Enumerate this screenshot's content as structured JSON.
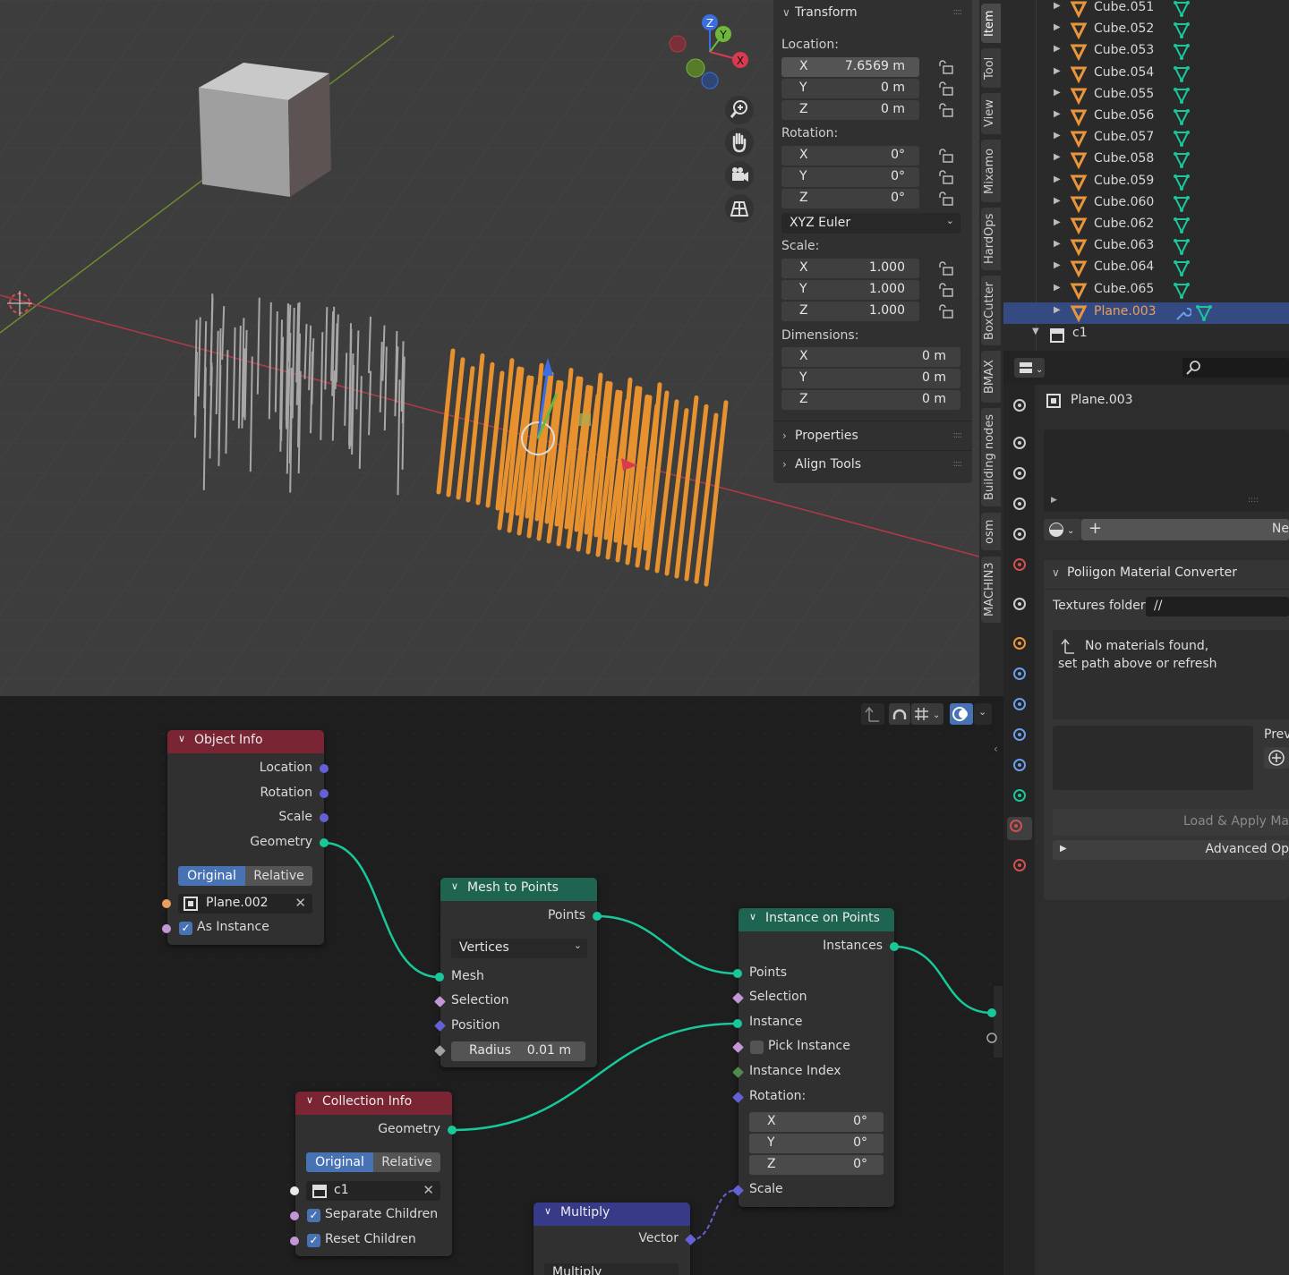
{
  "npanel": {
    "transform_title": "Transform",
    "location_label": "Location:",
    "location": [
      {
        "axis": "X",
        "value": "7.6569 m"
      },
      {
        "axis": "Y",
        "value": "0 m"
      },
      {
        "axis": "Z",
        "value": "0 m"
      }
    ],
    "rotation_label": "Rotation:",
    "rotation": [
      {
        "axis": "X",
        "value": "0°"
      },
      {
        "axis": "Y",
        "value": "0°"
      },
      {
        "axis": "Z",
        "value": "0°"
      }
    ],
    "rotation_mode": "XYZ Euler",
    "scale_label": "Scale:",
    "scale": [
      {
        "axis": "X",
        "value": "1.000"
      },
      {
        "axis": "Y",
        "value": "1.000"
      },
      {
        "axis": "Z",
        "value": "1.000"
      }
    ],
    "dimensions_label": "Dimensions:",
    "dimensions": [
      {
        "axis": "X",
        "value": "0 m"
      },
      {
        "axis": "Y",
        "value": "0 m"
      },
      {
        "axis": "Z",
        "value": "0 m"
      }
    ],
    "properties_title": "Properties",
    "align_title": "Align Tools"
  },
  "gizmo": {
    "x": "X",
    "y": "Y",
    "z": "Z"
  },
  "vtabs": [
    "Item",
    "Tool",
    "View",
    "Mixamo",
    "HardOps",
    "BoxCutter",
    "BMAX",
    "Building nodes",
    "osm",
    "MACHIN3"
  ],
  "outliner": {
    "items": [
      "Cube.051",
      "Cube.052",
      "Cube.053",
      "Cube.054",
      "Cube.055",
      "Cube.056",
      "Cube.057",
      "Cube.058",
      "Cube.059",
      "Cube.060",
      "Cube.062",
      "Cube.063",
      "Cube.064",
      "Cube.065"
    ],
    "selected": "Plane.003",
    "collection": "c1"
  },
  "props": {
    "object_name": "Plane.003",
    "new_label": "Ne",
    "panel_title": "Poliigon Material Converter",
    "textures_label": "Textures folder:",
    "textures_value": "//",
    "message_line1": "No materials found,",
    "message_line2": "set path above or refresh",
    "preview_label": "Prev",
    "load_label": "Load & Apply Ma",
    "advanced_label": "Advanced Op"
  },
  "nodes": {
    "object_info": {
      "title": "Object Info",
      "outputs": [
        "Location",
        "Rotation",
        "Scale",
        "Geometry"
      ],
      "mode_on": "Original",
      "mode_off": "Relative",
      "object": "Plane.002",
      "as_instance": "As Instance"
    },
    "mesh_to_points": {
      "title": "Mesh to Points",
      "output": "Points",
      "mode": "Vertices",
      "inputs": [
        "Mesh",
        "Selection",
        "Position"
      ],
      "radius_label": "Radius",
      "radius_value": "0.01 m"
    },
    "instance_on_points": {
      "title": "Instance on Points",
      "output": "Instances",
      "inputs": [
        "Points",
        "Selection",
        "Instance"
      ],
      "pick_instance": "Pick Instance",
      "instance_index": "Instance Index",
      "rotation_label": "Rotation:",
      "rotation": [
        {
          "axis": "X",
          "value": "0°"
        },
        {
          "axis": "Y",
          "value": "0°"
        },
        {
          "axis": "Z",
          "value": "0°"
        }
      ],
      "scale": "Scale"
    },
    "collection_info": {
      "title": "Collection Info",
      "output": "Geometry",
      "mode_on": "Original",
      "mode_off": "Relative",
      "collection": "c1",
      "separate_children": "Separate Children",
      "reset_children": "Reset Children"
    },
    "multiply": {
      "title": "Multiply",
      "output": "Vector",
      "mode": "Multiply"
    }
  },
  "colors": {
    "accent": "#4772b3",
    "selected_object": "#e8a05a",
    "geometry_socket": "#19c79a"
  }
}
